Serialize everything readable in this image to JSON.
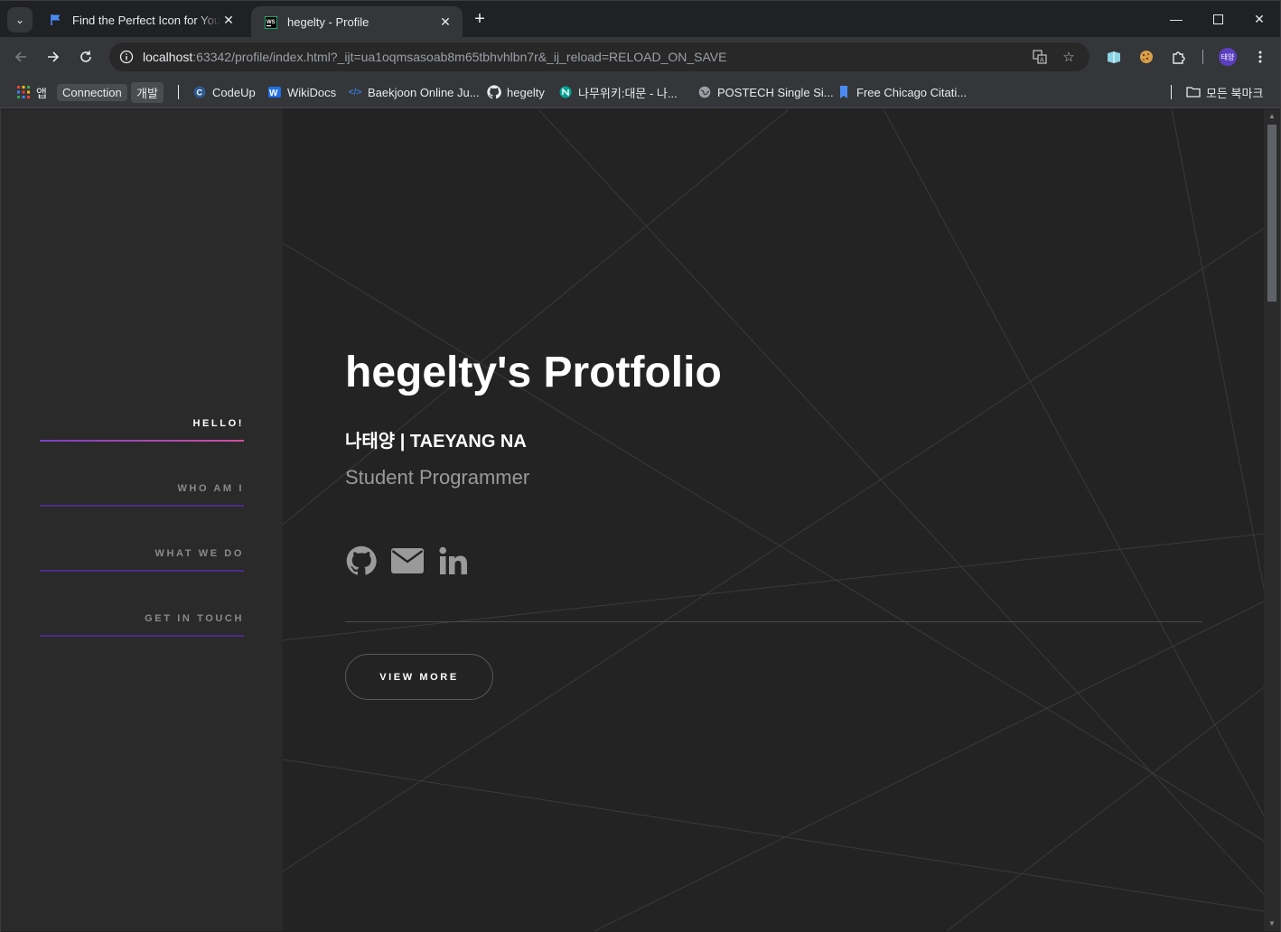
{
  "browser": {
    "tabs": [
      {
        "title": "Find the Perfect Icon for Your Project",
        "favicon": "flag-icon",
        "active": false
      },
      {
        "title": "hegelty - Profile",
        "favicon": "webstorm-icon",
        "active": true
      }
    ],
    "url": {
      "host": "localhost",
      "rest": ":63342/profile/index.html?_ijt=ua1oqmsasoab8m65tbhvhlbn7r&_ij_reload=RELOAD_ON_SAVE"
    },
    "profile_initials": "태양",
    "bookmarks": [
      {
        "label": "앱",
        "icon": "apps-grid-icon"
      },
      {
        "label": "Connection",
        "type": "chip"
      },
      {
        "label": "개발",
        "type": "chip"
      },
      {
        "label": "CodeUp",
        "icon": "codeup-icon"
      },
      {
        "label": "WikiDocs",
        "icon": "wikidocs-icon"
      },
      {
        "label": "Baekjoon Online Ju...",
        "icon": "code-brackets-icon"
      },
      {
        "label": "hegelty",
        "icon": "github-icon"
      },
      {
        "label": "나무위키:대문 - 나...",
        "icon": "namuwiki-icon"
      },
      {
        "label": "POSTECH Single Si...",
        "icon": "globe-icon"
      },
      {
        "label": "Free Chicago Citati...",
        "icon": "bookmark-icon"
      }
    ],
    "all_bookmarks": "모든 북마크"
  },
  "sidebar": {
    "items": [
      {
        "label": "HELLO!",
        "active": true
      },
      {
        "label": "WHO AM I",
        "active": false
      },
      {
        "label": "WHAT WE DO",
        "active": false
      },
      {
        "label": "GET IN TOUCH",
        "active": false
      }
    ]
  },
  "hero": {
    "title": "hegelty's Protfolio",
    "name": "나태양 | TAEYANG NA",
    "role": "Student Programmer",
    "social_icons": [
      "github-icon",
      "envelope-icon",
      "linkedin-icon"
    ],
    "button_label": "VIEW MORE"
  },
  "colors": {
    "page_bg": "#232323",
    "sidebar_bg": "#2a2a2a",
    "accent_start": "#7b3fc4",
    "accent_end": "#d04fa0",
    "inactive_underline": "#4a2d8a"
  }
}
